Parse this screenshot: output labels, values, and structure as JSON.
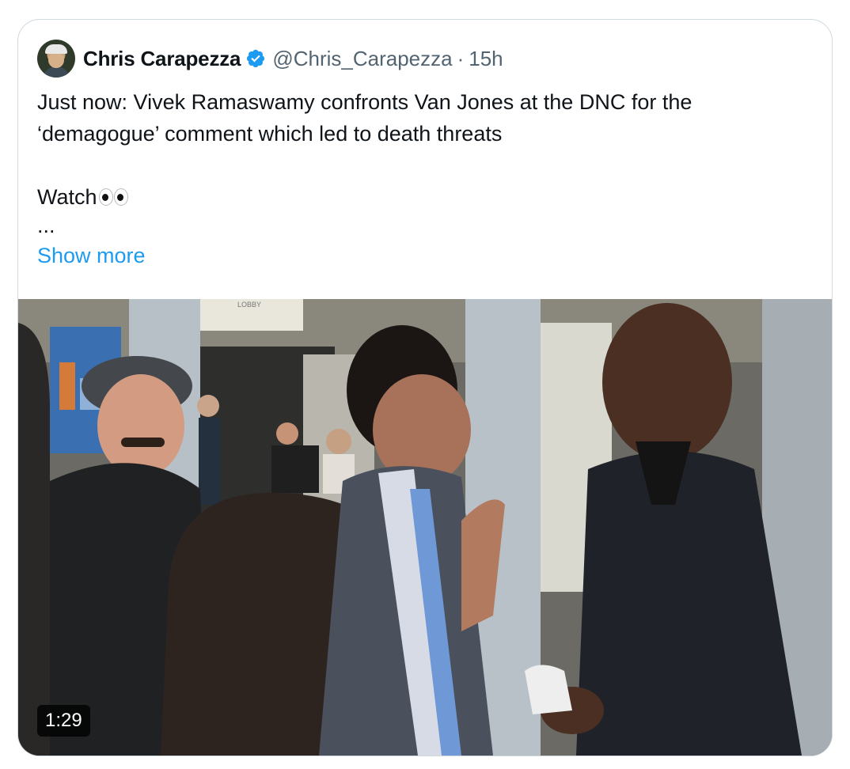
{
  "tweet": {
    "author_name": "Chris Carapezza",
    "handle": "@Chris_Carapezza",
    "separator": "·",
    "time": "15h",
    "text_lines": [
      "Just now: Vivek Ramaswamy confronts Van Jones at the DNC for the",
      "‘demagogue’ comment which led to death threats"
    ],
    "watch_text": "Watch",
    "ellipsis": "...",
    "show_more": "Show more"
  },
  "media": {
    "duration": "1:29",
    "sign_text": "LOBBY"
  },
  "colors": {
    "link": "#1d9bf0",
    "verified": "#1d9bf0",
    "secondary_text": "#536471",
    "border": "#cfd9de"
  },
  "icons": {
    "verified": "verified-badge-icon",
    "eyes": "eyes-emoji-icon"
  }
}
